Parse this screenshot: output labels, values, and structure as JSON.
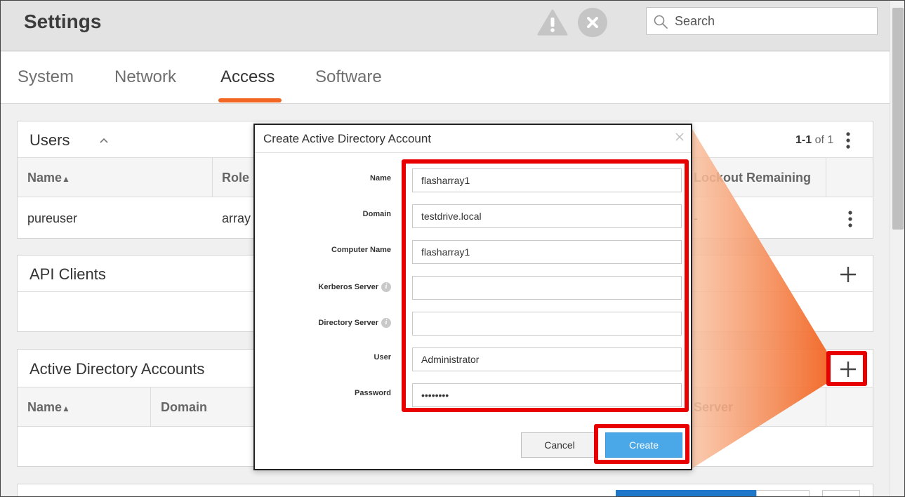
{
  "header": {
    "title": "Settings",
    "search_placeholder": "Search"
  },
  "tabs": [
    {
      "label": "System"
    },
    {
      "label": "Network"
    },
    {
      "label": "Access",
      "active": true
    },
    {
      "label": "Software"
    }
  ],
  "accent_color": "#f26522",
  "users": {
    "title": "Users",
    "pagination": {
      "range": "1-1",
      "of_text": "of 1"
    },
    "columns": [
      "Name",
      "Role",
      "Lockout Remaining"
    ],
    "rows": [
      {
        "name": "pureuser",
        "role": "array",
        "lockout": "-"
      }
    ]
  },
  "api_clients": {
    "title": "API Clients"
  },
  "ad_accounts": {
    "title": "Active Directory Accounts",
    "columns": [
      "Name",
      "Domain",
      "Server"
    ]
  },
  "modal": {
    "title": "Create Active Directory Account",
    "fields": [
      {
        "label": "Name",
        "value": "flasharray1"
      },
      {
        "label": "Domain",
        "value": "testdrive.local"
      },
      {
        "label": "Computer Name",
        "value": "flasharray1"
      },
      {
        "label": "Kerberos Server",
        "value": "",
        "info": true
      },
      {
        "label": "Directory Server",
        "value": "",
        "info": true
      },
      {
        "label": "User",
        "value": "Administrator"
      },
      {
        "label": "Password",
        "value": "12345678"
      }
    ],
    "cancel_label": "Cancel",
    "create_label": "Create",
    "create_color": "#4aa8e8"
  },
  "callout_color": "#e80000"
}
